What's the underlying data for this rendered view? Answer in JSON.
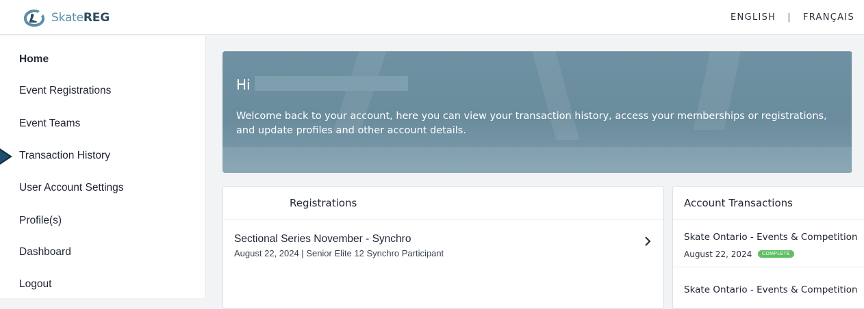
{
  "header": {
    "logo_text_a": "Skate",
    "logo_text_b": "REG",
    "lang_english": "ENGLISH",
    "lang_separator": "|",
    "lang_french": "FRANÇAIS"
  },
  "sidebar": {
    "items": [
      {
        "label": "Home",
        "active": true
      },
      {
        "label": "Event Registrations"
      },
      {
        "label": "Event Teams"
      },
      {
        "label": "Transaction History"
      },
      {
        "label": "User Account Settings"
      },
      {
        "label": "Profile(s)"
      },
      {
        "label": "Dashboard"
      },
      {
        "label": "Logout"
      }
    ]
  },
  "hero": {
    "greeting": "Hi",
    "message": "Welcome back to your account, here you can view your transaction history, access your memberships or registrations, and update profiles and other account details."
  },
  "registrations": {
    "title": "Registrations",
    "items": [
      {
        "title": "Sectional Series November - Synchro",
        "subtitle": "August 22, 2024 | Senior Elite 12 Synchro Participant"
      }
    ]
  },
  "transactions": {
    "title": "Account Transactions",
    "items": [
      {
        "title": "Skate Ontario - Events & Competition",
        "date": "August 22, 2024",
        "status": "COMPLETE"
      },
      {
        "title": "Skate Ontario - Events & Competition",
        "date": "",
        "status": ""
      }
    ]
  },
  "colors": {
    "hero_bg": "#6e92a3",
    "badge_green": "#5fbf64",
    "brand_dark": "#2c4d5e"
  }
}
